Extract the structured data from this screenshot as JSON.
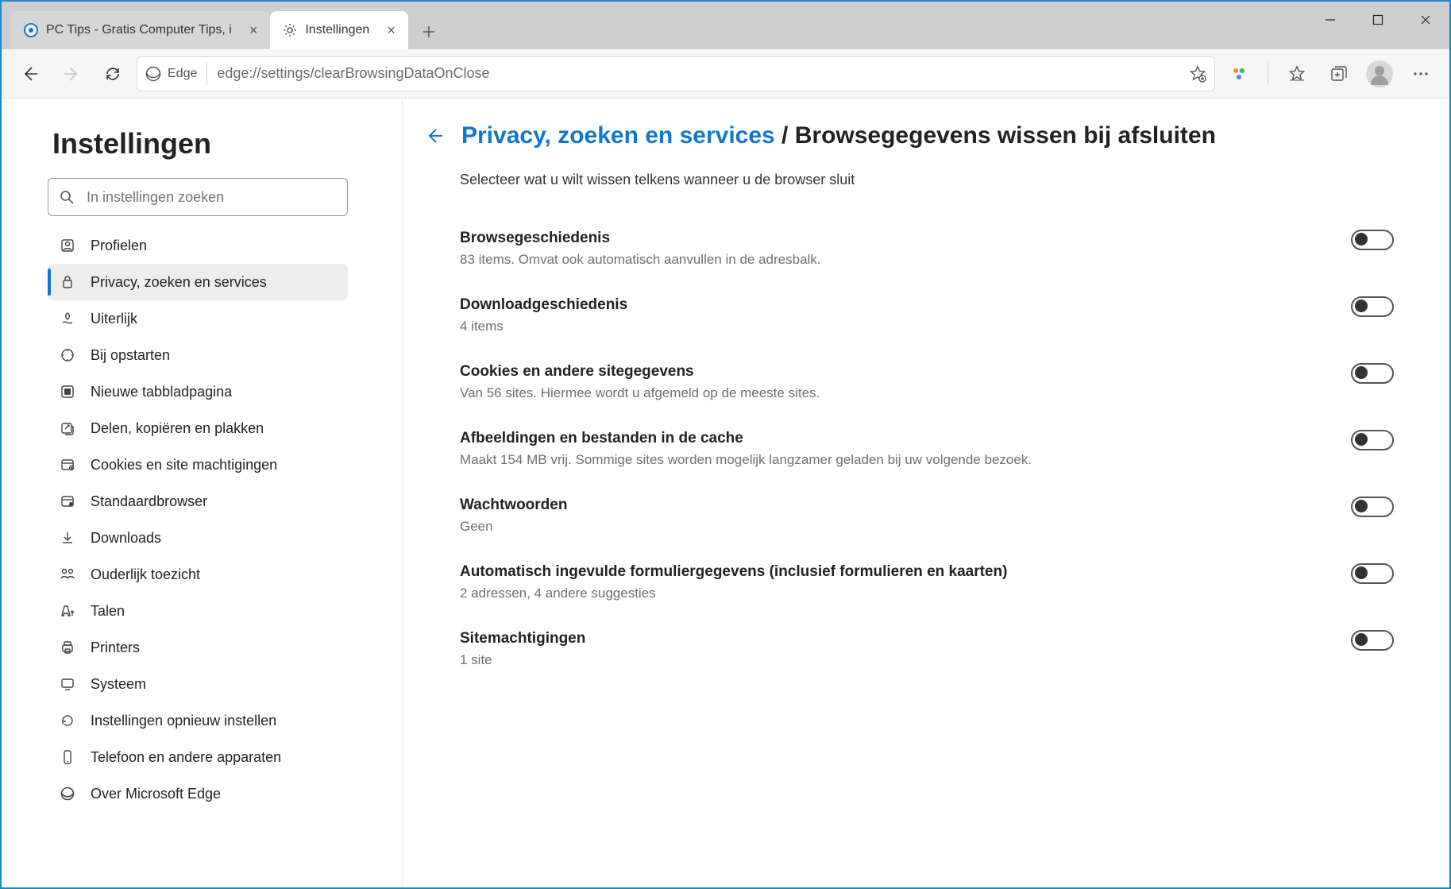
{
  "window": {
    "tabs": [
      {
        "label": "PC Tips - Gratis Computer Tips, i",
        "active": false
      },
      {
        "label": "Instellingen",
        "active": true
      }
    ]
  },
  "urlbar": {
    "product": "Edge",
    "url": "edge://settings/clearBrowsingDataOnClose"
  },
  "sidebar": {
    "title": "Instellingen",
    "search_placeholder": "In instellingen zoeken",
    "items": [
      {
        "label": "Profielen"
      },
      {
        "label": "Privacy, zoeken en services"
      },
      {
        "label": "Uiterlijk"
      },
      {
        "label": "Bij opstarten"
      },
      {
        "label": "Nieuwe tabbladpagina"
      },
      {
        "label": "Delen, kopiëren en plakken"
      },
      {
        "label": "Cookies en site machtigingen"
      },
      {
        "label": "Standaardbrowser"
      },
      {
        "label": "Downloads"
      },
      {
        "label": "Ouderlijk toezicht"
      },
      {
        "label": "Talen"
      },
      {
        "label": "Printers"
      },
      {
        "label": "Systeem"
      },
      {
        "label": "Instellingen opnieuw instellen"
      },
      {
        "label": "Telefoon en andere apparaten"
      },
      {
        "label": "Over Microsoft Edge"
      }
    ],
    "active_index": 1
  },
  "breadcrumb": {
    "parent": "Privacy, zoeken en services",
    "separator": "/",
    "current": "Browsegegevens wissen bij afsluiten"
  },
  "subtitle": "Selecteer wat u wilt wissen telkens wanneer u de browser sluit",
  "options": [
    {
      "title": "Browsegeschiedenis",
      "desc": "83 items. Omvat ook automatisch aanvullen in de adresbalk.",
      "on": false
    },
    {
      "title": "Downloadgeschiedenis",
      "desc": "4 items",
      "on": false
    },
    {
      "title": "Cookies en andere sitegegevens",
      "desc": "Van 56 sites. Hiermee wordt u afgemeld op de meeste sites.",
      "on": false
    },
    {
      "title": "Afbeeldingen en bestanden in de cache",
      "desc": "Maakt 154 MB vrij. Sommige sites worden mogelijk langzamer geladen bij uw volgende bezoek.",
      "on": false
    },
    {
      "title": "Wachtwoorden",
      "desc": "Geen",
      "on": false
    },
    {
      "title": "Automatisch ingevulde formuliergegevens (inclusief formulieren en kaarten)",
      "desc": "2 adressen, 4 andere suggesties",
      "on": false
    },
    {
      "title": "Sitemachtigingen",
      "desc": "1 site",
      "on": false
    }
  ]
}
